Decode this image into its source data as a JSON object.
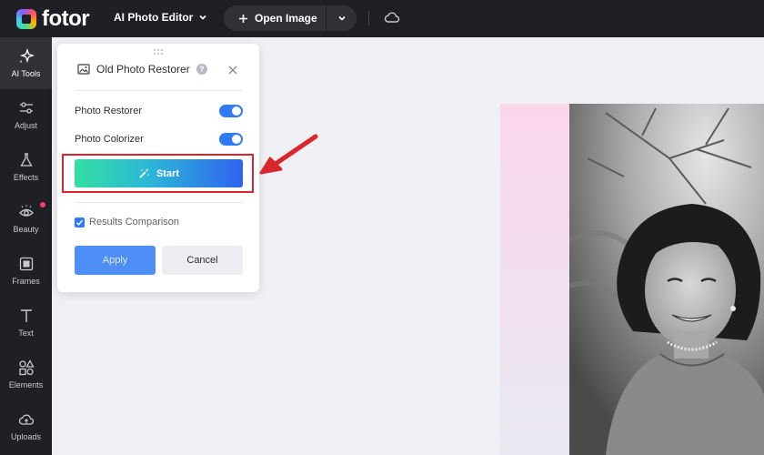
{
  "topbar": {
    "logo_text": "fotor",
    "app_menu_label": "AI Photo Editor",
    "open_image_label": "Open Image",
    "icons": [
      "logo-icon",
      "chevron-down-icon",
      "plus-icon",
      "cloud-icon"
    ]
  },
  "sidebar": {
    "items": [
      {
        "label": "AI Tools",
        "icon": "sparkle-icon",
        "active": true
      },
      {
        "label": "Adjust",
        "icon": "sliders-icon"
      },
      {
        "label": "Effects",
        "icon": "flask-icon"
      },
      {
        "label": "Beauty",
        "icon": "eye-icon",
        "badge": true
      },
      {
        "label": "Frames",
        "icon": "frame-icon"
      },
      {
        "label": "Text",
        "icon": "text-icon"
      },
      {
        "label": "Elements",
        "icon": "shapes-icon"
      },
      {
        "label": "Uploads",
        "icon": "upload-cloud-icon"
      }
    ]
  },
  "panel": {
    "title": "Old Photo Restorer",
    "help_glyph": "?",
    "options": [
      {
        "label": "Photo Restorer",
        "enabled": true
      },
      {
        "label": "Photo Colorizer",
        "enabled": true
      }
    ],
    "start_label": "Start",
    "comparison_label": "Results Comparison",
    "comparison_checked": true,
    "apply_label": "Apply",
    "cancel_label": "Cancel"
  },
  "colors": {
    "topbar_bg": "#1f2025",
    "accent_blue": "#2f7bf6",
    "highlight_red": "#d9262c",
    "start_gradient": [
      "#33e0a1",
      "#2f63f0"
    ]
  }
}
